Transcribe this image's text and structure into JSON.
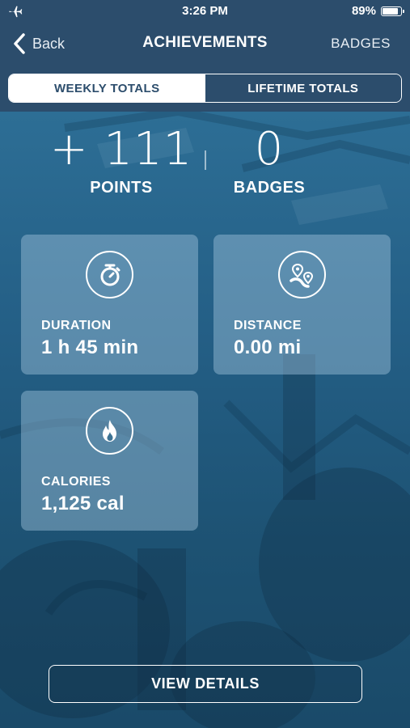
{
  "status_bar": {
    "time": "3:26 PM",
    "battery_percent": "89%",
    "airplane_icon": "airplane-icon",
    "battery_icon": "battery-icon"
  },
  "nav": {
    "back_label": "Back",
    "title": "ACHIEVEMENTS",
    "right_label": "BADGES"
  },
  "tabs": [
    {
      "label": "WEEKLY TOTALS",
      "active": true
    },
    {
      "label": "LIFETIME TOTALS",
      "active": false
    }
  ],
  "summary": {
    "points_value": "+ 111",
    "points_label": "POINTS",
    "badges_value": "0",
    "badges_label": "BADGES"
  },
  "cards": [
    {
      "icon": "stopwatch-icon",
      "label": "DURATION",
      "value": "1 h 45 min"
    },
    {
      "icon": "route-pin-icon",
      "label": "DISTANCE",
      "value": "0.00 mi"
    },
    {
      "icon": "flame-icon",
      "label": "CALORIES",
      "value": "1,125 cal"
    }
  ],
  "actions": {
    "view_details_label": "VIEW DETAILS"
  },
  "colors": {
    "header_bg": "#2c4d6c",
    "content_bg": "#245f86",
    "card_bg": "rgba(160,195,220,0.45)",
    "text": "#ffffff"
  }
}
